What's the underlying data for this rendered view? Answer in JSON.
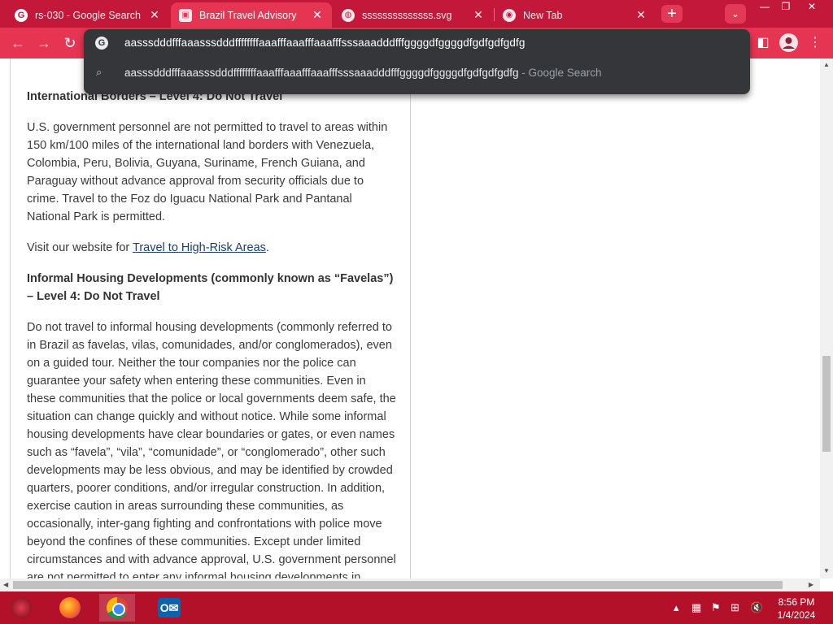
{
  "tabs": [
    {
      "title": "rs-030 - Google Search",
      "favicon": "google-icon",
      "active": false
    },
    {
      "title": "Brazil Travel Advisory",
      "favicon": "site-icon",
      "active": true
    },
    {
      "title": "ssssssssssssss.svg",
      "favicon": "globe-icon",
      "active": false
    },
    {
      "title": "New Tab",
      "favicon": "chrome-icon",
      "active": false
    }
  ],
  "tab_close_glyph": "✕",
  "new_tab_glyph": "+",
  "omnibox": {
    "input_text": "aasssdddfffaaasssdddffffffffaaafffaaafffaaafffsssaaadddfffggggdfggggdfgdfgdfgdfg",
    "suggestion_query": "aasssdddfffaaasssdddffffffffaaafffaaafffaaafffsssaaadddfffggggdfggggdfgdfgdfgdfg",
    "suggestion_suffix": " - Google Search"
  },
  "article": {
    "h1": "International Borders – Level 4: Do Not Travel",
    "p1": "U.S. government personnel are not permitted to travel to areas within 150 km/100 miles of the international land borders with Venezuela, Colombia, Peru, Bolivia, Guyana, Suriname, French Guiana, and Paraguay without advance approval from security officials due to crime. Travel to the Foz do Iguacu National Park and Pantanal National Park is permitted.",
    "p2_prefix": "Visit our website for ",
    "p2_link": "Travel to High-Risk Areas",
    "p2_suffix": ".",
    "h2": "Informal Housing Developments (commonly known as “Favelas”) – Level 4: Do Not Travel",
    "p3": "Do not travel to informal housing developments (commonly referred to in Brazil as favelas, vilas, comunidades, and/or conglomerados), even on a guided tour.  Neither the tour companies nor the police can guarantee your safety when entering these communities.  Even in these communities that the police or local governments deem safe, the situation can change quickly and without notice.  While some informal housing developments have clear boundaries or gates, or even names such as “favela”, “vila”, “comunidade”, or “conglomerado”, other such developments may be less obvious, and may be identified by crowded quarters, poorer conditions, and/or irregular construction.  In addition, exercise caution in areas surrounding these communities, as occasionally, inter-gang fighting and confrontations with police move beyond the confines of these communities.  Except under limited circumstances and with advance approval, U.S. government personnel are not permitted to enter any informal housing developments in"
  },
  "clock": {
    "time": "8:56 PM",
    "date": "1/4/2024"
  },
  "colors": {
    "tabstrip": "#c4183a",
    "toolbar": "#e63552",
    "taskbar": "#b3112a",
    "omnibox": "#35363a"
  }
}
